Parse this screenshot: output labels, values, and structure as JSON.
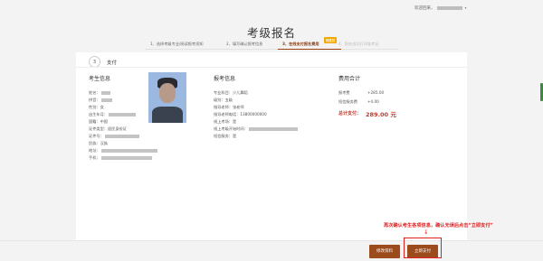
{
  "header": {
    "welcome": "欢迎回来，",
    "title": "考级报名"
  },
  "steps": [
    {
      "label": "1、选择考级专业/阅读报考须知"
    },
    {
      "label": "2、填写确认报考信息"
    },
    {
      "label": "3、在线支付报名费用",
      "badge": "待支付"
    },
    {
      "label": "4、报名成功打印准考证"
    }
  ],
  "payment": {
    "step_number": "3",
    "label": "支付"
  },
  "candidate": {
    "title": "考生信息",
    "name_label": "姓名：",
    "pinyin_label": "拼音：",
    "gender_label": "性别：",
    "gender_value": "女",
    "birth_label": "出生年月：",
    "nation_label": "国籍：",
    "nation_value": "中国",
    "id_type_label": "证件类型：",
    "id_type_value": "居民身份证",
    "id_no_label": "证件号：",
    "ethnic_label": "民族：",
    "ethnic_value": "汉族",
    "address_label": "地址：",
    "phone_label": "手机："
  },
  "exam": {
    "title": "报考信息",
    "major_label": "专业科目：",
    "major_value": "少儿舞蹈",
    "level_label": "级别：",
    "level_value": "五级",
    "teacher_label": "指导老师：",
    "teacher_value": "张老师",
    "teacher_phone_label": "指导老师电话：",
    "teacher_phone_value": "13800000000",
    "online_label": "线上考场：",
    "online_value": "是",
    "time_label": "线上考级开始时间：",
    "service_label": "短信服务：",
    "service_value": "是"
  },
  "fees": {
    "title": "费用合计",
    "exam_fee_label": "报考费",
    "exam_fee_value": "+285.00",
    "sms_fee_label": "短信服务费",
    "sms_fee_value": "+4.00",
    "total_label": "总计支付：",
    "total_value": "289.00 元"
  },
  "actions": {
    "modify": "修改资料",
    "pay": "立即支付",
    "hint": "再次确认考生各项信息，确认无误后点击“立即支付”"
  }
}
